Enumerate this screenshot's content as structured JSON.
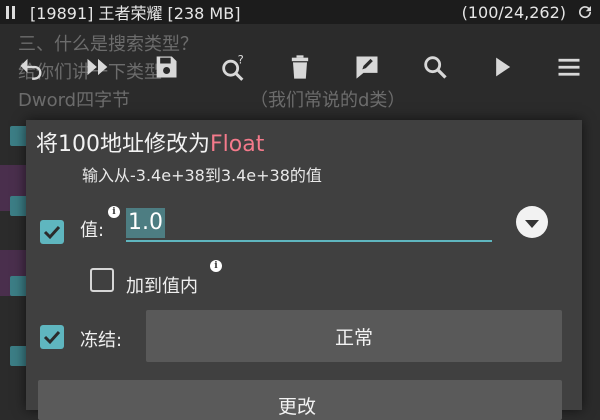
{
  "status_bar": {
    "title": "[19891] 王者荣耀 [238 MB]",
    "count": "(100/24,262)"
  },
  "background_text": {
    "line1": "三、什么是搜索类型？",
    "line2": "给你们讲一下类型",
    "line3": "Dword四字节",
    "line4": "（我们常说的d类）"
  },
  "toolbar": {
    "icons": [
      "undo-icon",
      "fast-forward-icon",
      "save-icon",
      "search-help-icon",
      "delete-icon",
      "edit-icon",
      "search-icon",
      "play-icon",
      "menu-icon"
    ]
  },
  "dialog": {
    "title_prefix": "将100地址修改为",
    "title_type": "Float",
    "subtitle": "输入从-3.4e+38到3.4e+38的值",
    "value_label": "值:",
    "value": "1.0",
    "add_to_value_label": "加到值内",
    "freeze_label": "冻结:",
    "freeze_mode": "正常",
    "bottom_button_label": "更改"
  },
  "colors": {
    "accent": "#5fb6bf",
    "title_accent": "#f47a8b",
    "dialog_bg": "#404040"
  }
}
